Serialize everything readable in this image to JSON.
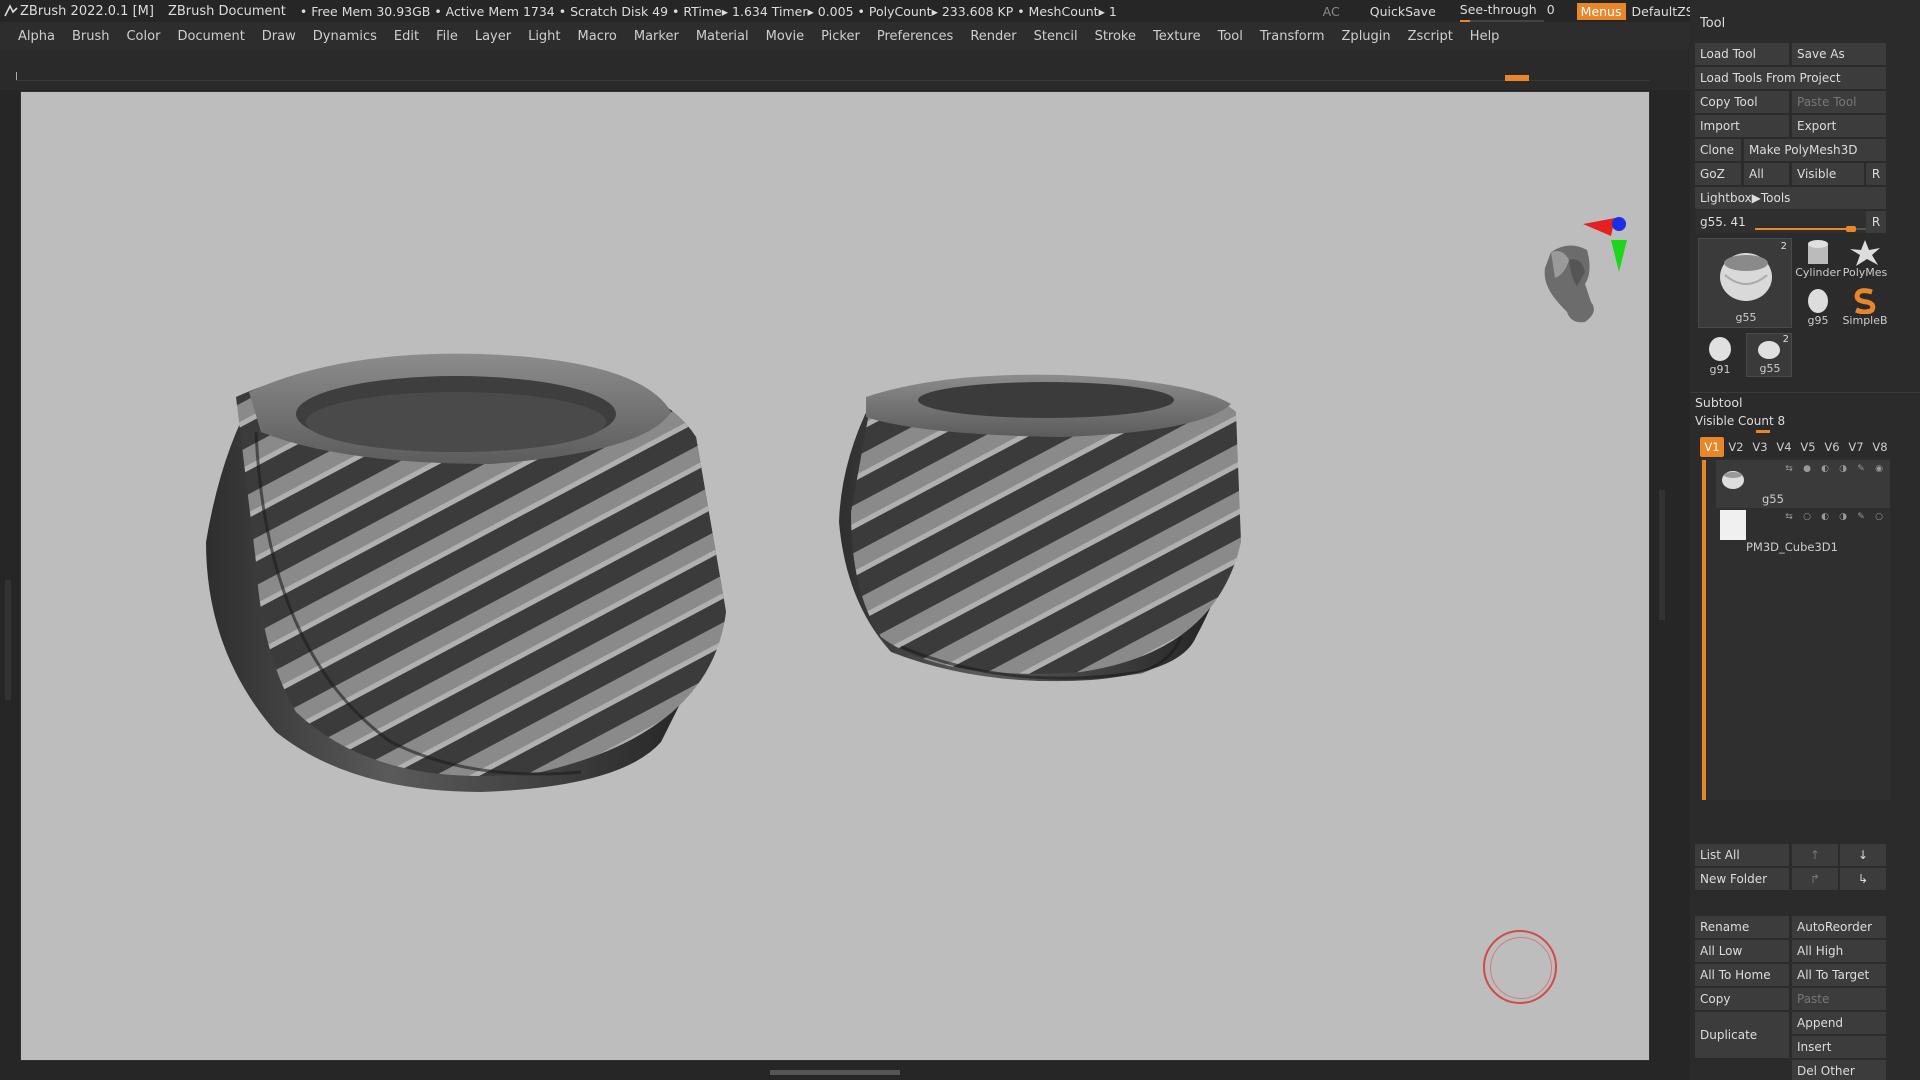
{
  "titlebar": {
    "app": "ZBrush 2022.0.1 [M]",
    "document": "ZBrush Document",
    "status": "• Free Mem 30.93GB • Active Mem 1734 • Scratch Disk 49 •  RTime▸ 1.634 Timer▸ 0.005 • PolyCount▸ 233.608 KP  • MeshCount▸ 1",
    "ac": "AC",
    "quicksave": "QuickSave",
    "seethrough": "See-through",
    "seethrough_value": "0",
    "seethrough_level": 0.12,
    "menus": "Menus",
    "script": "DefaultZScript"
  },
  "menubar": {
    "items": [
      "Alpha",
      "Brush",
      "Color",
      "Document",
      "Draw",
      "Dynamics",
      "Edit",
      "File",
      "Layer",
      "Light",
      "Macro",
      "Marker",
      "Material",
      "Movie",
      "Picker",
      "Preferences",
      "Render",
      "Stencil",
      "Stroke",
      "Texture",
      "Tool",
      "Transform",
      "Zplugin",
      "Zscript",
      "Help"
    ]
  },
  "tool": {
    "title": "Tool",
    "load_tool": "Load Tool",
    "save_as": "Save As",
    "load_from_project": "Load Tools From Project",
    "copy_tool": "Copy Tool",
    "paste_tool": "Paste Tool",
    "import": "Import",
    "export": "Export",
    "clone": "Clone",
    "make_polymesh": "Make PolyMesh3D",
    "goz": "GoZ",
    "all": "All",
    "visible": "Visible",
    "r": "R",
    "lightbox": "Lightbox▶Tools",
    "current": "g55. 41",
    "current_fraction": 0.8,
    "thumbs": {
      "main": {
        "label": "g55",
        "badge": "2"
      },
      "cylinder": "Cylinder",
      "polymesh": "PolyMes",
      "g95": "g95",
      "simple": "SimpleB",
      "g91": "g91",
      "g55b": {
        "label": "g55",
        "badge": "2"
      }
    }
  },
  "subtool": {
    "title": "Subtool",
    "visible_count": "Visible Count 8",
    "tabs": [
      "V1",
      "V2",
      "V3",
      "V4",
      "V5",
      "V6",
      "V7",
      "V8"
    ],
    "items": [
      {
        "name": "g55"
      },
      {
        "name": "PM3D_Cube3D1"
      }
    ],
    "list_all": "List All",
    "new_folder": "New Folder",
    "rename": "Rename",
    "autoreorder": "AutoReorder",
    "all_low": "All Low",
    "all_high": "All High",
    "all_to_home": "All To Home",
    "all_to_target": "All To Target",
    "copy": "Copy",
    "paste": "Paste",
    "duplicate": "Duplicate",
    "append": "Append",
    "insert": "Insert",
    "del_other": "Del Other"
  },
  "colors": {
    "accent": "#e8862a",
    "canvas": "#bdbdbd",
    "panel": "#2b2b2b"
  }
}
